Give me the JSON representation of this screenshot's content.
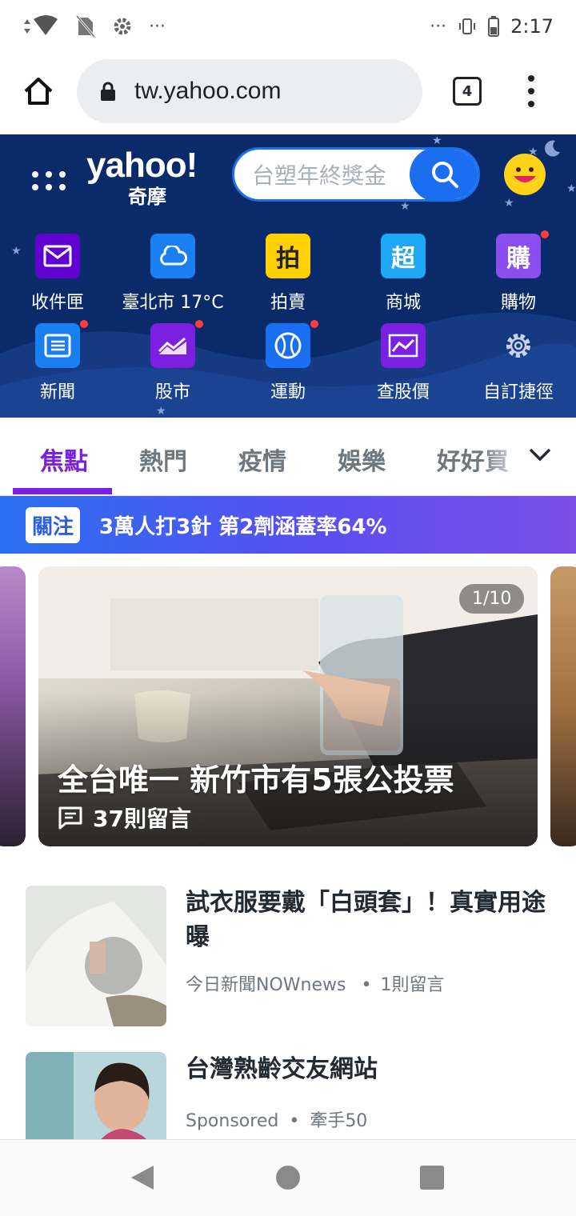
{
  "status_bar": {
    "time": "2:17",
    "more_dots": "···"
  },
  "browser": {
    "url": "tw.yahoo.com",
    "tab_count": "4"
  },
  "yahoo": {
    "logo": "yahoo!",
    "logo_sub": "奇摩",
    "search_placeholder": "台塑年終獎金",
    "shortcuts": [
      {
        "label": "收件匣",
        "icon": "mail-icon",
        "color": "#6001d2",
        "dot": false
      },
      {
        "label": "臺北市 17°C",
        "icon": "cloud-icon",
        "color": "#1a7ff0",
        "dot": false
      },
      {
        "label": "拍賣",
        "icon": "auction-icon",
        "color": "#ffd000",
        "dot": false
      },
      {
        "label": "商城",
        "icon": "mall-icon",
        "color": "#1ea7f5",
        "dot": false
      },
      {
        "label": "購物",
        "icon": "shopping-icon",
        "color": "#8a4ef0",
        "dot": true
      },
      {
        "label": "新聞",
        "icon": "news-icon",
        "color": "#1a7ff0",
        "dot": true
      },
      {
        "label": "股市",
        "icon": "stock-icon",
        "color": "#7b1fe0",
        "dot": true
      },
      {
        "label": "運動",
        "icon": "sports-icon",
        "color": "#1a6ff0",
        "dot": true
      },
      {
        "label": "查股價",
        "icon": "stock-quote-icon",
        "color": "#7b1fe0",
        "dot": false
      },
      {
        "label": "自訂捷徑",
        "icon": "gear-icon",
        "color": "transparent",
        "dot": false
      }
    ]
  },
  "categories": [
    {
      "label": "焦點",
      "active": true
    },
    {
      "label": "熱門",
      "active": false
    },
    {
      "label": "疫情",
      "active": false
    },
    {
      "label": "娛樂",
      "active": false
    },
    {
      "label": "好好買",
      "active": false
    }
  ],
  "banner": {
    "tag": "關注",
    "text": "3萬人打3針 第2劑涵蓋率64%"
  },
  "carousel": {
    "counter": "1/10",
    "title": "全台唯一 新竹市有5張公投票",
    "comments": "37則留言"
  },
  "articles": [
    {
      "title": "試衣服要戴「白頭套」！真實用途曝",
      "source": "今日新聞NOWnews",
      "comments": "1則留言"
    },
    {
      "title": "台灣熟齡交友網站",
      "source": "Sponsored",
      "comments": "牽手50"
    }
  ]
}
